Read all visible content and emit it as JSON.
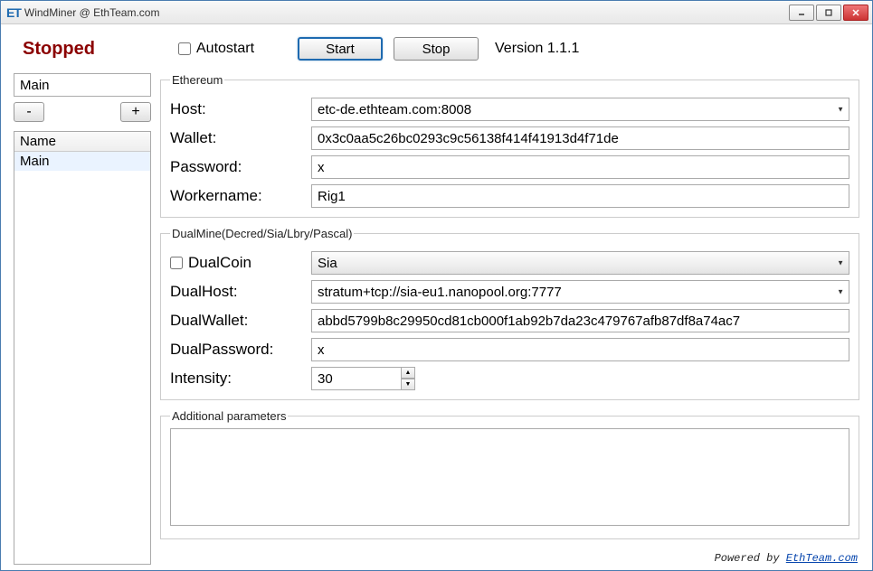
{
  "window": {
    "title": "WindMiner @ EthTeam.com",
    "icon_text": "ET"
  },
  "header": {
    "status": "Stopped",
    "autostart_label": "Autostart",
    "autostart_checked": false,
    "start_label": "Start",
    "stop_label": "Stop",
    "version_label": "Version 1.1.1"
  },
  "sidebar": {
    "profile_selected": "Main",
    "remove_label": "-",
    "add_label": "+",
    "table_header": "Name",
    "rows": [
      "Main"
    ]
  },
  "ethereum": {
    "legend": "Ethereum",
    "host_label": "Host:",
    "host_value": "etc-de.ethteam.com:8008",
    "wallet_label": "Wallet:",
    "wallet_value": "0x3c0aa5c26bc0293c9c56138f414f41913d4f71de",
    "password_label": "Password:",
    "password_value": "x",
    "workername_label": "Workername:",
    "workername_value": "Rig1"
  },
  "dualmine": {
    "legend": "DualMine(Decred/Sia/Lbry/Pascal)",
    "dualcoin_label": "DualCoin",
    "dualcoin_checked": false,
    "dualcoin_value": "Sia",
    "dualhost_label": "DualHost:",
    "dualhost_value": "stratum+tcp://sia-eu1.nanopool.org:7777",
    "dualwallet_label": "DualWallet:",
    "dualwallet_value": "abbd5799b8c29950cd81cb000f1ab92b7da23c479767afb87df8a74ac7",
    "dualpassword_label": "DualPassword:",
    "dualpassword_value": "x",
    "intensity_label": "Intensity:",
    "intensity_value": "30"
  },
  "additional": {
    "legend": "Additional parameters",
    "value": ""
  },
  "footer": {
    "text": "Powered by ",
    "link_text": "EthTeam.com"
  }
}
